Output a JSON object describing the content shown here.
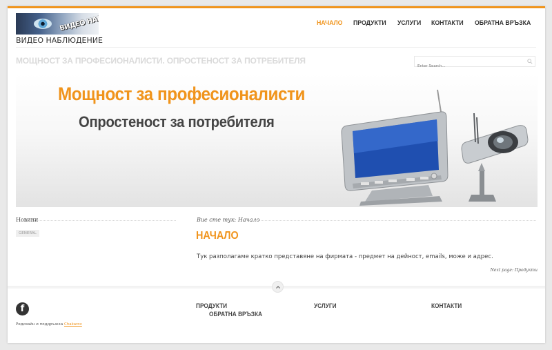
{
  "header": {
    "logo_text": "ВИДЕО НАБЛЮДЕНИЕ",
    "site_name": "ВИДЕО НАБЛЮДЕНИЕ",
    "nav": [
      {
        "label": "НАЧАЛО",
        "active": true
      },
      {
        "label": "ПРОДУКТИ",
        "active": false
      },
      {
        "label": "УСЛУГИ",
        "active": false
      },
      {
        "label": "КОНТАКТИ",
        "active": false
      },
      {
        "label": "ОБРАТНА ВРЪЗКА",
        "active": false
      }
    ]
  },
  "tagline": "МОЩНОСТ ЗА ПРОФЕСИОНАЛИСТИ. ОПРОСТЕНОСТ ЗА ПОТРЕБИТЕЛЯ",
  "search": {
    "placeholder": "Enter Search..."
  },
  "banner": {
    "headline": "Мощност за професионалисти",
    "subheadline": "Опростеност за потребителя"
  },
  "sidebar": {
    "title": "Новини",
    "tags": [
      "GENERAL"
    ]
  },
  "content": {
    "breadcrumb": "Вие сте тук: Начало",
    "title": "НАЧАЛО",
    "body": "Тук разполагаме кратко представяне на фирмата - предмет на дейност, emails, може и адрес.",
    "next_page": "Next page: Продукти"
  },
  "footer": {
    "credits_prefix": "Редизайн и поддръжка ",
    "credits_link": "Chakarov",
    "links": [
      "ПРОДУКТИ",
      "ОБРАТНА ВРЪЗКА",
      "УСЛУГИ",
      "КОНТАКТИ"
    ]
  },
  "colors": {
    "accent": "#f0941c",
    "text": "#333333"
  }
}
